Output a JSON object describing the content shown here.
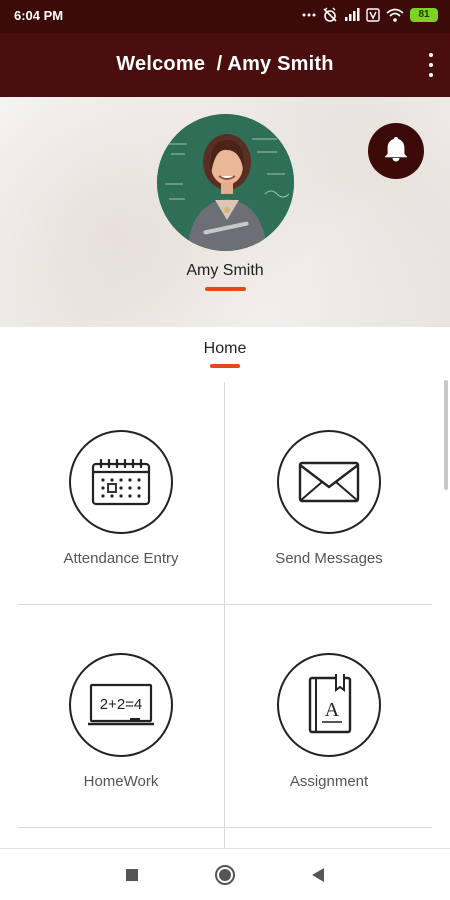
{
  "status_bar": {
    "time": "6:04 PM",
    "battery": "81",
    "icons": [
      "signal-dots-icon",
      "alarm-off-icon",
      "cell-signal-icon",
      "volte-icon",
      "wifi-icon",
      "battery-icon"
    ]
  },
  "app_bar": {
    "title": "Welcome  / Amy Smith",
    "menu_icon": "more-vert-icon"
  },
  "profile": {
    "name": "Amy Smith",
    "notification_icon": "bell-icon"
  },
  "tabs": {
    "active": "Home"
  },
  "menu": {
    "items": [
      {
        "label": "Attendance Entry",
        "icon": "calendar-icon"
      },
      {
        "label": "Send Messages",
        "icon": "envelope-icon"
      },
      {
        "label": "HomeWork",
        "icon": "chalkboard-icon"
      },
      {
        "label": "Assignment",
        "icon": "book-icon"
      }
    ],
    "chalkboard_text": "2+2=4",
    "book_letter": "A"
  },
  "colors": {
    "app_bar": "#4a0e0e",
    "status_bar": "#3d0a0a",
    "accent": "#e8461b",
    "battery": "#7ed321"
  },
  "nav_bar": {
    "icons": [
      "recents-square-icon",
      "home-circle-icon",
      "back-triangle-icon"
    ]
  }
}
